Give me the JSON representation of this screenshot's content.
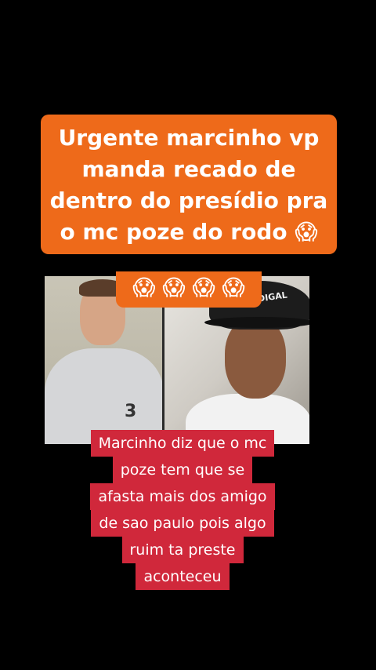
{
  "headline": {
    "text": "Urgente marcinho vp manda recado de dentro do presídio pra o mc poze do rodo 😱",
    "emojis": "😱 😱 😱 😱"
  },
  "photos": {
    "left_number": "3",
    "right_hat_text": "DIGAL"
  },
  "caption": {
    "lines": [
      "Marcinho diz que o mc",
      "poze tem que se",
      "afasta mais dos amigo",
      "de sao paulo pois algo",
      "ruim ta preste",
      "aconteceu"
    ]
  },
  "colors": {
    "headline_bg": "#ee6a1a",
    "caption_bg": "#d0283b",
    "background": "#000000"
  }
}
